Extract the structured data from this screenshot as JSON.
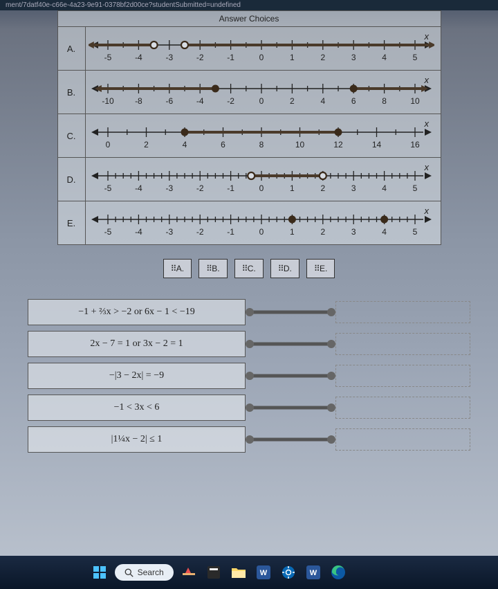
{
  "url_fragment": "ment/7datf40e-c66e-4a23-9e91-0378bf2d00ce?studentSubmitted=undefined",
  "header": {
    "title": "Answer Choices"
  },
  "numberlines": [
    {
      "label": "A.",
      "min": -5,
      "max": 5,
      "step": 1,
      "minor": 0.5,
      "x_label": "x",
      "points": [
        {
          "v": -3.5,
          "open": true
        },
        {
          "v": -2.5,
          "open": true
        }
      ],
      "segments": [
        {
          "from": -5.5,
          "to": -3.5,
          "arrowL": true
        },
        {
          "from": -2.5,
          "to": 5.5,
          "arrowR": true
        }
      ]
    },
    {
      "label": "B.",
      "min": -10,
      "max": 10,
      "step": 2,
      "minor": 1,
      "x_label": "x",
      "points": [
        {
          "v": -3,
          "open": false
        },
        {
          "v": 6,
          "open": false
        }
      ],
      "segments": [
        {
          "from": -10.5,
          "to": -3,
          "arrowL": true
        },
        {
          "from": 6,
          "to": 10.5,
          "arrowR": true
        }
      ]
    },
    {
      "label": "C.",
      "min": 0,
      "max": 16,
      "step": 2,
      "minor": 1,
      "x_label": "x",
      "points": [
        {
          "v": 4,
          "open": false
        },
        {
          "v": 12,
          "open": false
        }
      ],
      "segments": [
        {
          "from": 4,
          "to": 12
        }
      ]
    },
    {
      "label": "D.",
      "min": -5,
      "max": 5,
      "step": 1,
      "minor": 0.25,
      "x_label": "x",
      "points": [
        {
          "v": -0.333,
          "open": true
        },
        {
          "v": 2,
          "open": true
        }
      ],
      "segments": [
        {
          "from": -0.333,
          "to": 2
        }
      ]
    },
    {
      "label": "E.",
      "min": -5,
      "max": 5,
      "step": 1,
      "minor": 0.25,
      "x_label": "x",
      "points": [
        {
          "v": 1,
          "open": false
        },
        {
          "v": 4,
          "open": false
        }
      ],
      "segments": []
    }
  ],
  "tiles": [
    "A.",
    "B.",
    "C.",
    "D.",
    "E."
  ],
  "equations": [
    "−1 + ⅔x > −2 or 6x − 1 < −19",
    "2x − 7 = 1 or 3x − 2 = 1",
    "−|3 − 2x| = −9",
    "−1 < 3x < 6",
    "|1¼x − 2| ≤ 1"
  ],
  "taskbar": {
    "search_placeholder": "Search"
  }
}
